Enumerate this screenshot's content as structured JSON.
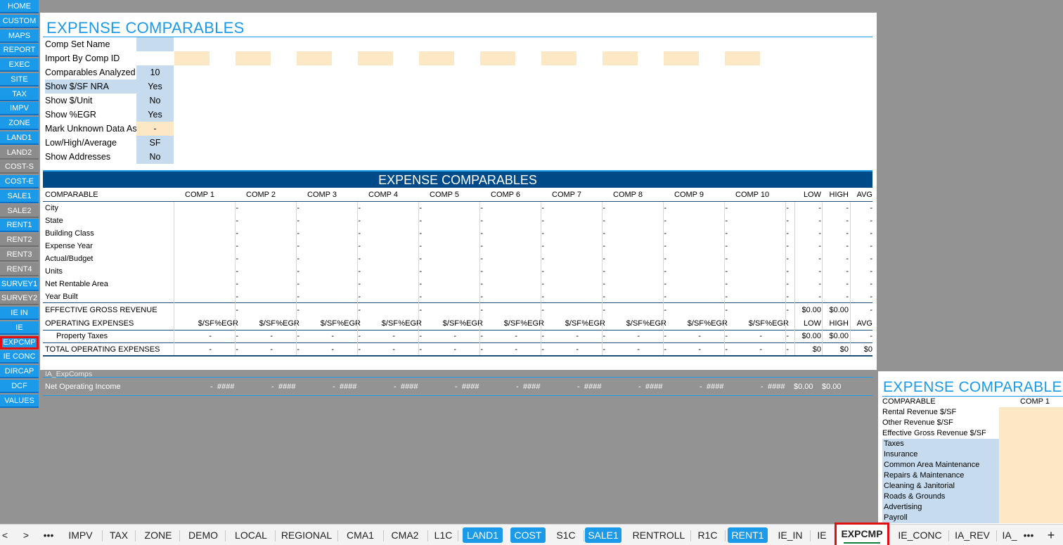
{
  "nav": [
    {
      "label": "HOME",
      "style": "blue"
    },
    {
      "label": "CUSTOM",
      "style": "blue"
    },
    {
      "label": "MAPS",
      "style": "blue"
    },
    {
      "label": "REPORT",
      "style": "blue"
    },
    {
      "label": "EXEC",
      "style": "blue"
    },
    {
      "label": "SITE",
      "style": "blue"
    },
    {
      "label": "TAX",
      "style": "blue"
    },
    {
      "label": "IMPV",
      "style": "blue"
    },
    {
      "label": "ZONE",
      "style": "blue"
    },
    {
      "label": "LAND1",
      "style": "blue"
    },
    {
      "label": "LAND2",
      "style": "gray"
    },
    {
      "label": "COST-S",
      "style": "gray"
    },
    {
      "label": "COST-E",
      "style": "blue"
    },
    {
      "label": "SALE1",
      "style": "blue"
    },
    {
      "label": "SALE2",
      "style": "gray"
    },
    {
      "label": "RENT1",
      "style": "blue"
    },
    {
      "label": "RENT2",
      "style": "gray"
    },
    {
      "label": "RENT3",
      "style": "gray"
    },
    {
      "label": "RENT4",
      "style": "gray"
    },
    {
      "label": "SURVEY1",
      "style": "blue"
    },
    {
      "label": "SURVEY2",
      "style": "gray"
    },
    {
      "label": "IE IN",
      "style": "blue"
    },
    {
      "label": "IE",
      "style": "blue"
    },
    {
      "label": "EXPCMP",
      "style": "blue",
      "selected": true
    },
    {
      "label": "IE CONC",
      "style": "blue"
    },
    {
      "label": "DIRCAP",
      "style": "blue"
    },
    {
      "label": "DCF",
      "style": "blue"
    },
    {
      "label": "VALUES",
      "style": "blue"
    }
  ],
  "title": "EXPENSE COMPARABLES",
  "settings": [
    {
      "label": "Comp Set Name",
      "value": "",
      "style": "blue"
    },
    {
      "label": "Import By Comp ID",
      "value": null,
      "style": "none"
    },
    {
      "label": "Comparables Analyzed",
      "value": "10",
      "style": "blue"
    },
    {
      "label": "Show $/SF NRA",
      "value": "Yes",
      "style": "blue",
      "highlight": true
    },
    {
      "label": "Show $/Unit",
      "value": "No",
      "style": "blue"
    },
    {
      "label": "Show %EGR",
      "value": "Yes",
      "style": "blue"
    },
    {
      "label": "Mark Unknown Data As",
      "value": "-",
      "style": "tan"
    },
    {
      "label": "Low/High/Average",
      "value": "SF",
      "style": "blue"
    },
    {
      "label": "Show Addresses",
      "value": "No",
      "style": "blue"
    }
  ],
  "banner": "EXPENSE COMPARABLES",
  "header": {
    "label": "COMPARABLE",
    "comps": [
      "COMP 1",
      "COMP 2",
      "COMP 3",
      "COMP 4",
      "COMP 5",
      "COMP 6",
      "COMP 7",
      "COMP 8",
      "COMP 9",
      "COMP 10"
    ],
    "stats": [
      "LOW",
      "HIGH",
      "AVG"
    ]
  },
  "info_rows": [
    "City",
    "State",
    "Building Class",
    "Expense Year",
    "Actual/Budget",
    "Units",
    "Net Rentable Area",
    "Year Built"
  ],
  "dash": "-",
  "egr_row": {
    "label": "EFFECTIVE GROSS REVENUE",
    "low": "$0.00",
    "high": "$0.00",
    "avg": "-"
  },
  "opex_row": {
    "label": "OPERATING EXPENSES",
    "sf": "$/SF",
    "egr": "%EGR",
    "low": "LOW",
    "high": "HIGH",
    "avg": "AVG"
  },
  "tax_row": {
    "label": "Property Taxes",
    "low": "$0.00",
    "high": "$0.00",
    "avg": "-"
  },
  "total_row": {
    "label": "TOTAL OPERATING EXPENSES",
    "low": "$0",
    "high": "$0",
    "avg": "$0"
  },
  "gray_strip": {
    "caption": "IA_ExpComps",
    "label": "Net Operating Income",
    "dash": "-",
    "hash": "####",
    "low": "$0.00",
    "high": "$0.00"
  },
  "right_pane": {
    "title": "EXPENSE COMPARABLES",
    "header_label": "COMPARABLE",
    "header_comp": "COMP 1",
    "rows": [
      {
        "label": "Rental Revenue $/SF",
        "hl": false
      },
      {
        "label": "Other Revenue $/SF",
        "hl": false
      },
      {
        "label": "Effective Gross Revenue $/SF",
        "hl": false
      },
      {
        "label": "Taxes",
        "hl": true
      },
      {
        "label": "Insurance",
        "hl": true
      },
      {
        "label": "Common Area Maintenance",
        "hl": true
      },
      {
        "label": "Repairs & Maintenance",
        "hl": true
      },
      {
        "label": "Cleaning & Janitorial",
        "hl": true
      },
      {
        "label": "Roads & Grounds",
        "hl": true
      },
      {
        "label": "Advertising",
        "hl": true
      },
      {
        "label": "Payroll",
        "hl": true
      }
    ]
  },
  "tabs": {
    "prev": "<",
    "next": ">",
    "more": "•••",
    "more_right": "•••",
    "add": "+",
    "items": [
      {
        "label": "IMPV",
        "style": "plain"
      },
      {
        "label": "TAX",
        "style": "plain"
      },
      {
        "label": "ZONE",
        "style": "plain"
      },
      {
        "label": "DEMO",
        "style": "plain"
      },
      {
        "label": "LOCAL",
        "style": "plain"
      },
      {
        "label": "REGIONAL",
        "style": "plain"
      },
      {
        "label": "CMA1",
        "style": "plain"
      },
      {
        "label": "CMA2",
        "style": "plain"
      },
      {
        "label": "L1C",
        "style": "plain"
      },
      {
        "label": "LAND1",
        "style": "blue"
      },
      {
        "label": "COST",
        "style": "blue"
      },
      {
        "label": "S1C",
        "style": "plain"
      },
      {
        "label": "SALE1",
        "style": "blue"
      },
      {
        "label": "RENTROLL",
        "style": "plain"
      },
      {
        "label": "R1C",
        "style": "plain"
      },
      {
        "label": "RENT1",
        "style": "blue"
      },
      {
        "label": "IE_IN",
        "style": "plain"
      },
      {
        "label": "IE",
        "style": "plain"
      },
      {
        "label": "EXPCMP",
        "style": "active"
      },
      {
        "label": "IE_CONC",
        "style": "plain"
      },
      {
        "label": "IA_REV",
        "style": "plain"
      },
      {
        "label": "IA_",
        "style": "plain"
      }
    ]
  }
}
